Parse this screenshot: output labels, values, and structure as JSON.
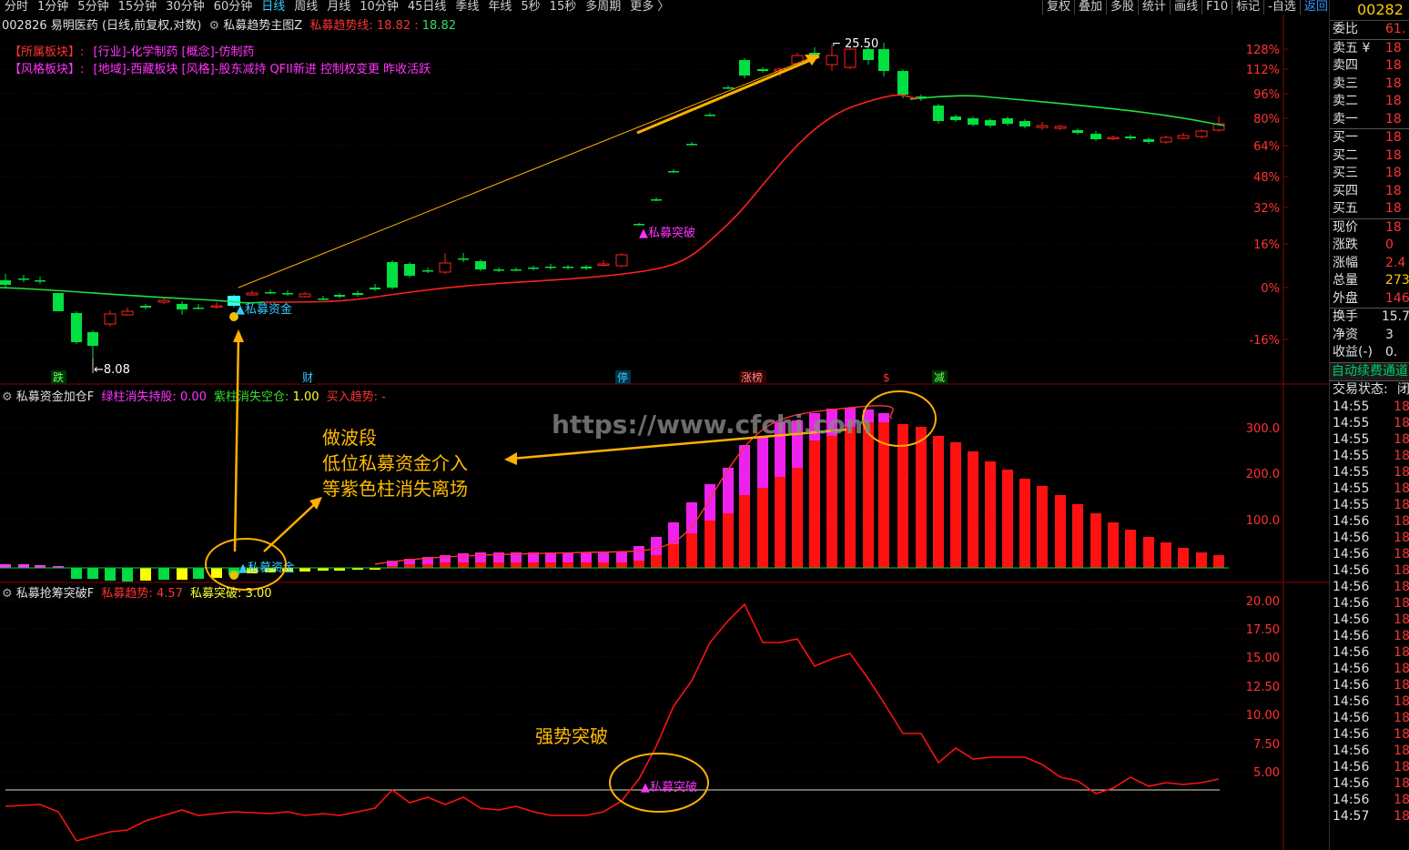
{
  "toolbar": {
    "periods": [
      "分时",
      "1分钟",
      "5分钟",
      "15分钟",
      "30分钟",
      "60分钟",
      "日线",
      "周线",
      "月线",
      "10分钟",
      "45日线",
      "季线",
      "年线",
      "5秒",
      "15秒",
      "多周期",
      "更多 〉"
    ],
    "active_period": "日线",
    "right": [
      "复权",
      "叠加",
      "多股",
      "统计",
      "画线",
      "F10",
      "标记",
      "-自选",
      "返回"
    ]
  },
  "main_panel": {
    "stock_code": "002826",
    "stock_name": "易明医药",
    "chart_desc": "(日线,前复权,对数)",
    "indicator_name": "私募趋势主图Z",
    "indicator_label": "私募趋势线:",
    "indicator_value": "18.82",
    "indicator_value2": "18.82",
    "sector_line_label": "【所属板块】:",
    "sector_line_value": "[行业]-化学制药 [概念]-仿制药",
    "style_line_label": "【风格板块】:",
    "style_line_value": "[地域]-西藏板块 [风格]-股东减持 QFII新进 控制权变更 昨收活跃",
    "y_ticks": [
      "128%",
      "112%",
      "96%",
      "80%",
      "64%",
      "48%",
      "32%",
      "16%",
      "0%",
      "-16%"
    ],
    "high_label": "25.50",
    "low_label": "8.08",
    "signal_breakthrough": "▲私募突破",
    "signal_fund": "▲私募资金",
    "bottom_tags": [
      "跌",
      "财",
      "停",
      "涨榜",
      "$",
      "减"
    ],
    "colors": {
      "up": "#ff2020",
      "down": "#00e040",
      "trend": "#ff2020",
      "ma": "#20e040",
      "arrow": "#ffb000"
    }
  },
  "panel2": {
    "title": "私募资金加仓F",
    "item1_label": "绿柱消失持股:",
    "item1_value": "0.00",
    "item2_label": "紫柱消失空仓:",
    "item2_value": "1.00",
    "item3_label": "买入趋势:",
    "item3_value": "-",
    "y_ticks": [
      "300.0",
      "200.0",
      "100.0"
    ],
    "signal_fund": "▲私募资金",
    "annotation_lines": [
      "做波段",
      "低位私募资金介入",
      "等紫色柱消失离场"
    ]
  },
  "panel3": {
    "title": "私募抢筹突破F",
    "item1_label": "私募趋势:",
    "item1_value": "4.57",
    "item2_label": "私募突破:",
    "item2_value": "3.00",
    "y_ticks": [
      "20.00",
      "17.50",
      "15.00",
      "12.50",
      "10.00",
      "7.50",
      "5.00"
    ],
    "annotation": "强势突破",
    "signal_breakthrough": "▲私募突破"
  },
  "watermark": "https://www.cfchi.com",
  "side_panel": {
    "code": "00282",
    "rows": [
      {
        "label": "委比",
        "value": "61."
      },
      {
        "label": "卖五 ¥",
        "value": "18"
      },
      {
        "label": "卖四",
        "value": "18"
      },
      {
        "label": "卖三",
        "value": "18"
      },
      {
        "label": "卖二",
        "value": "18"
      },
      {
        "label": "卖一",
        "value": "18"
      },
      {
        "label": "买一",
        "value": "18"
      },
      {
        "label": "买二",
        "value": "18"
      },
      {
        "label": "买三",
        "value": "18"
      },
      {
        "label": "买四",
        "value": "18"
      },
      {
        "label": "买五",
        "value": "18"
      },
      {
        "label": "现价",
        "value": "18"
      },
      {
        "label": "涨跌",
        "value": "0"
      },
      {
        "label": "涨幅",
        "value": "2.4"
      },
      {
        "label": "总量",
        "value": "273"
      },
      {
        "label": "外盘",
        "value": "146"
      },
      {
        "label": "换手",
        "value": "15.7"
      },
      {
        "label": "净资",
        "value": "3"
      },
      {
        "label": "收益(-)",
        "value": "0."
      }
    ],
    "auto_renew": "自动续费通道",
    "trade_status_label": "交易状态:",
    "trade_status_value": "闭",
    "ticks": [
      "14:55",
      "14:55",
      "14:55",
      "14:55",
      "14:55",
      "14:55",
      "14:55",
      "14:56",
      "14:56",
      "14:56",
      "14:56",
      "14:56",
      "14:56",
      "14:56",
      "14:56",
      "14:56",
      "14:56",
      "14:56",
      "14:56",
      "14:56",
      "14:56",
      "14:56",
      "14:56",
      "14:56",
      "14:56",
      "14:57"
    ],
    "tick_value": "18"
  }
}
